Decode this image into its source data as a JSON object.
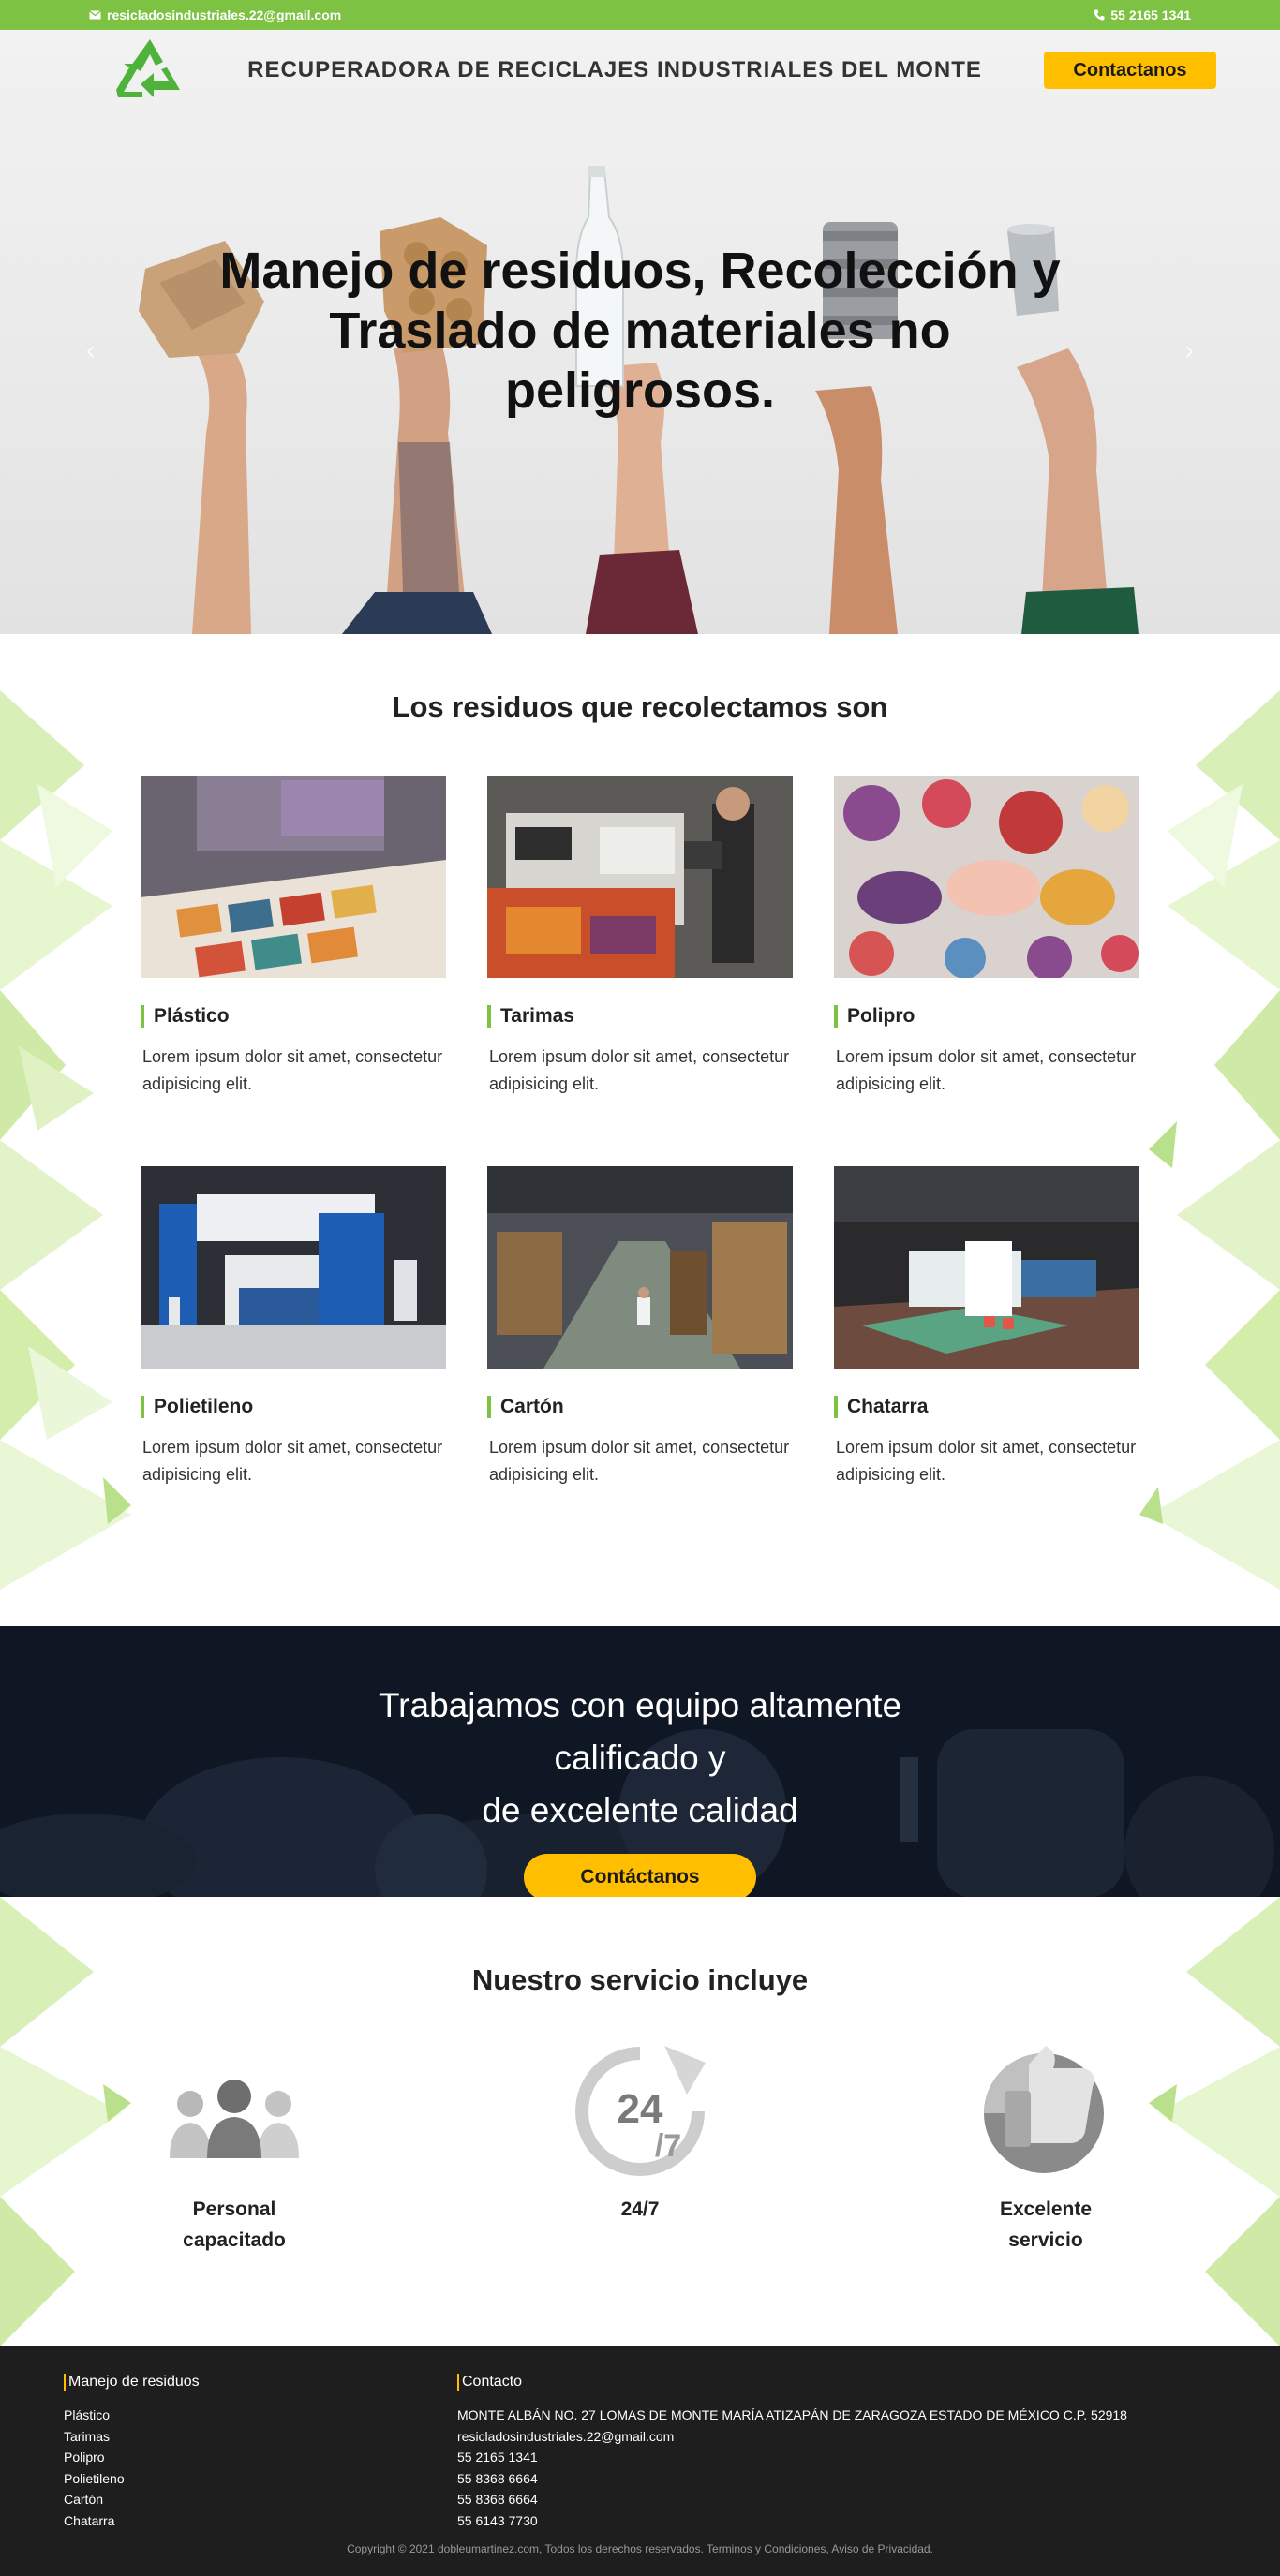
{
  "topbar": {
    "email": "resicladosindustriales.22@gmail.com",
    "phone": "55 2165 1341"
  },
  "header": {
    "title": "RECUPERADORA DE RECICLAJES INDUSTRIALES DEL MONTE",
    "cta_label": "Contactanos"
  },
  "hero": {
    "line1": "Manejo de residuos, Recolección y",
    "line2": "Traslado de materiales no",
    "line3": "peligrosos.",
    "prev_arrow": "‹",
    "next_arrow": "›"
  },
  "residuos": {
    "title": "Los residuos que recolectamos son",
    "cards": [
      {
        "title": "Plástico",
        "text": "Lorem ipsum dolor sit amet, consectetur adipisicing elit."
      },
      {
        "title": "Tarimas",
        "text": "Lorem ipsum dolor sit amet, consectetur adipisicing elit."
      },
      {
        "title": "Polipro",
        "text": "Lorem ipsum dolor sit amet, consectetur adipisicing elit."
      },
      {
        "title": "Polietileno",
        "text": "Lorem ipsum dolor sit amet, consectetur adipisicing elit."
      },
      {
        "title": "Cartón",
        "text": "Lorem ipsum dolor sit amet, consectetur adipisicing elit."
      },
      {
        "title": "Chatarra",
        "text": "Lorem ipsum dolor sit amet, consectetur adipisicing elit."
      }
    ]
  },
  "cta": {
    "line1": "Trabajamos con equipo altamente calificado y",
    "line2": "de excelente calidad",
    "button": "Contáctanos"
  },
  "servicios": {
    "title": "Nuestro servicio incluye",
    "items": [
      {
        "line1": "Personal",
        "line2": "capacitado"
      },
      {
        "line1": "24/7",
        "line2": ""
      },
      {
        "line1": "Excelente",
        "line2": "servicio"
      }
    ]
  },
  "footer": {
    "col1_title": "Manejo de residuos",
    "col1_items": [
      "Plástico",
      "Tarimas",
      "Polipro",
      "Polietileno",
      "Cartón",
      "Chatarra"
    ],
    "col2_title": "Contacto",
    "col2_items": [
      "MONTE ALBÁN NO. 27 LOMAS DE MONTE MARÍA ATIZAPÁN DE ZARAGOZA ESTADO DE MÉXICO C.P. 52918",
      "resicladosindustriales.22@gmail.com",
      "55 2165 1341",
      "55 8368 6664",
      "55 8368 6664",
      "55 6143 7730"
    ],
    "copyright": "Copyright © 2021 dobleumartinez.com, Todos los derechos reservados. Terminos y Condiciones, Aviso de Privacidad."
  },
  "colors": {
    "brand_green": "#7dc243",
    "accent_yellow": "#ffbf00",
    "cta_dark": "#0f1724",
    "footer_bg": "#1e1e1e"
  },
  "icons": [
    "envelope-icon",
    "phone-icon",
    "recycle-logo-icon",
    "people-icon",
    "clock-24-7-icon",
    "thumbs-up-icon"
  ]
}
